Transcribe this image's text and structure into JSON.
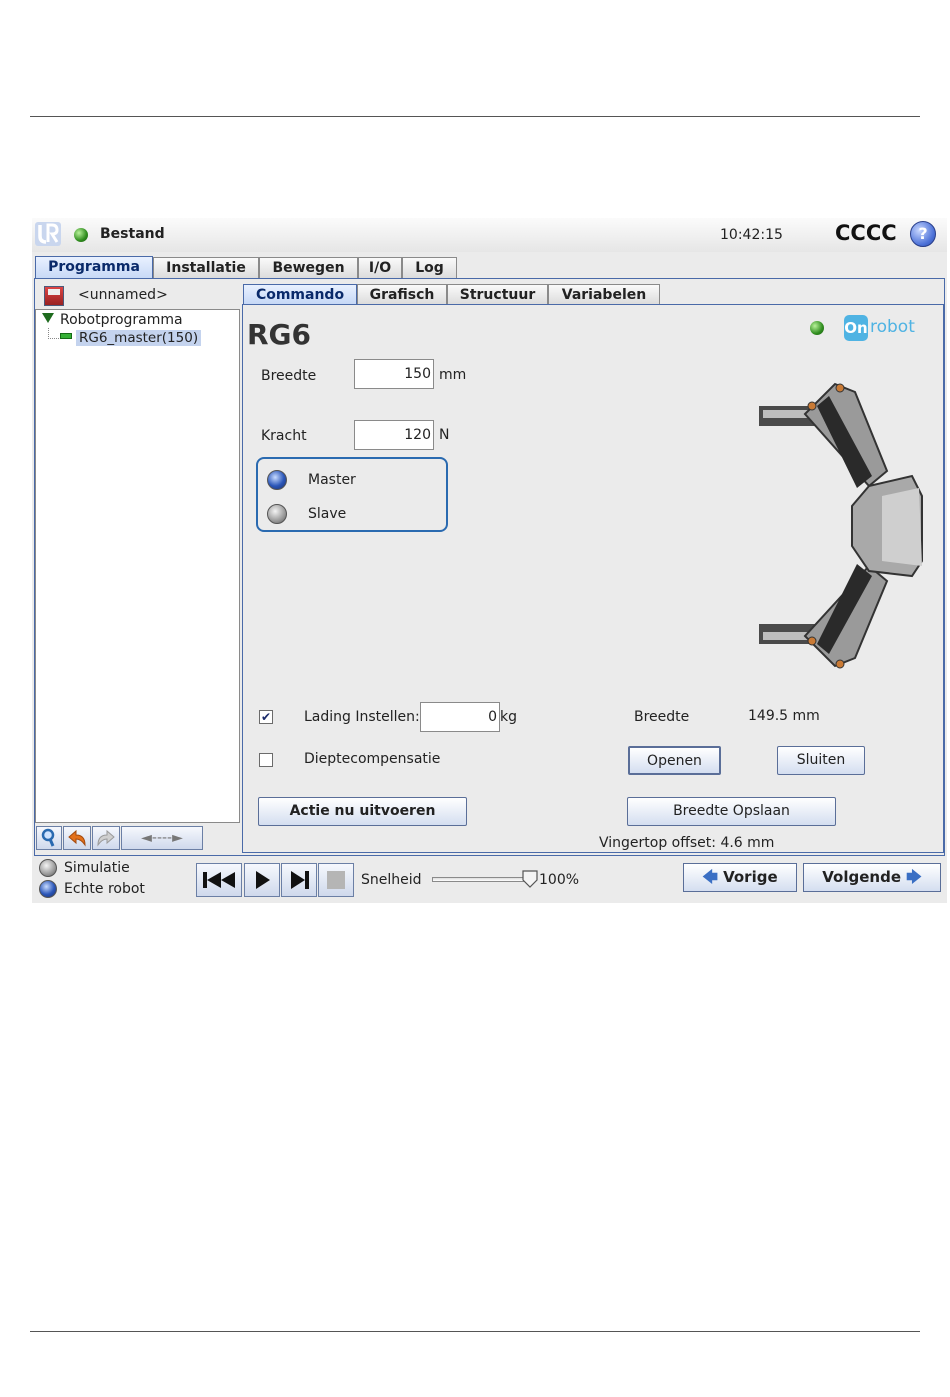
{
  "topbar": {
    "menu_label": "Bestand",
    "time": "10:42:15",
    "robot_name": "CCCC",
    "help_label": "?"
  },
  "main_tabs": [
    {
      "label": "Programma",
      "active": true
    },
    {
      "label": "Installatie",
      "active": false
    },
    {
      "label": "Bewegen",
      "active": false
    },
    {
      "label": "I/O",
      "active": false
    },
    {
      "label": "Log",
      "active": false
    }
  ],
  "program": {
    "filename": "<unnamed>",
    "tree_root": "Robotprogramma",
    "tree_child": "RG6_master(150)"
  },
  "tree_toolbar": {
    "nav_label": "◄----►"
  },
  "sub_tabs": [
    {
      "label": "Commando",
      "active": true
    },
    {
      "label": "Grafisch",
      "active": false
    },
    {
      "label": "Structuur",
      "active": false
    },
    {
      "label": "Variabelen",
      "active": false
    }
  ],
  "gripper": {
    "title": "RG6",
    "brand_badge": "On",
    "brand_text": "robot",
    "width_label": "Breedte",
    "width_value": "150",
    "width_unit": "mm",
    "force_label": "Kracht",
    "force_value": "120",
    "force_unit": "N",
    "mode_options": [
      {
        "label": "Master",
        "selected": true
      },
      {
        "label": "Slave",
        "selected": false
      }
    ],
    "payload_label": "Lading Instellen:",
    "payload_checked": true,
    "payload_value": "0",
    "payload_unit": "kg",
    "depth_label": "Dieptecompensatie",
    "depth_checked": false,
    "current_width_label": "Breedte",
    "current_width_value": "149.5 mm",
    "open_label": "Openen",
    "close_label": "Sluiten",
    "execute_label": "Actie nu uitvoeren",
    "save_width_label": "Breedte Opslaan",
    "fingertip_offset": "Vingertop offset: 4.6 mm"
  },
  "bottombar": {
    "simulation_label": "Simulatie",
    "real_robot_label": "Echte robot",
    "speed_label": "Snelheid",
    "speed_value": "100%",
    "speed_fraction": 1.0,
    "prev_label": "Vorige",
    "next_label": "Volgende"
  },
  "colors": {
    "accent": "#4a6aa8",
    "status_green": "#2f8c1e",
    "brand": "#4fb3e3"
  }
}
